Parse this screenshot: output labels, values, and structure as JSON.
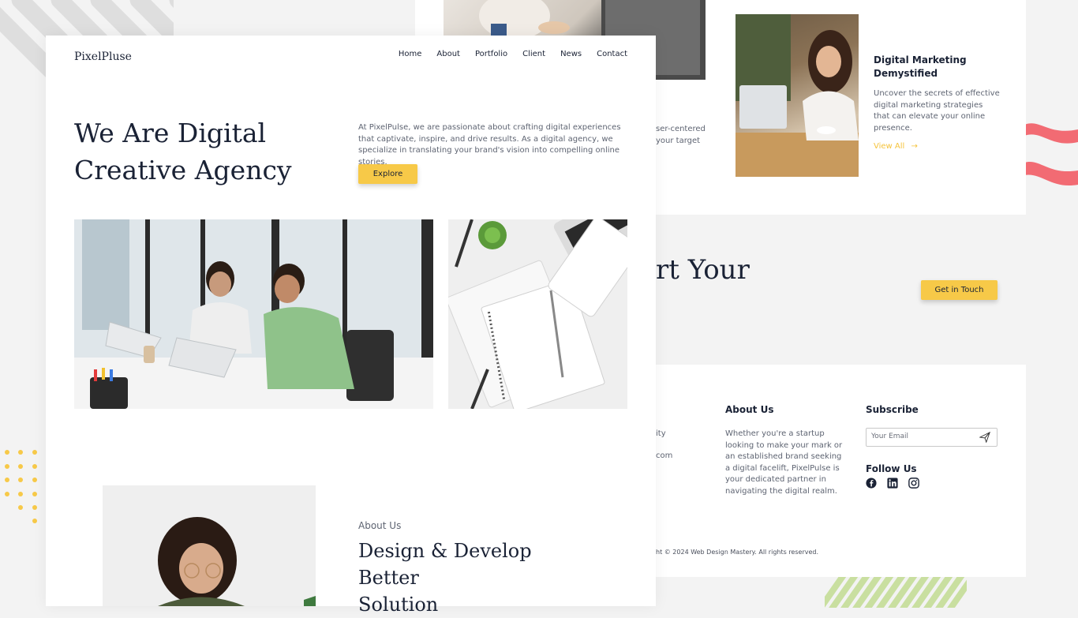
{
  "site": {
    "logo": "PixelPluse"
  },
  "nav": [
    "Home",
    "About",
    "Portfolio",
    "Client",
    "News",
    "Contact"
  ],
  "hero": {
    "title_line1": "We Are Digital",
    "title_line2": "Creative Agency",
    "text": "At PixelPulse, we are passionate about crafting digital experiences that captivate, inspire, and drive results. As a digital agency, we specialize in translating your brand's vision into compelling online stories.",
    "button": "Explore"
  },
  "about": {
    "label": "About Us",
    "title_line1": "Design & Develop Better",
    "title_line2": "Solution"
  },
  "back": {
    "cut_line1": "ser-centered",
    "cut_line2": "your target",
    "blog_title": "Digital Marketing Demystified",
    "blog_text": "Uncover the secrets of effective digital marketing strategies that can elevate your online presence.",
    "blog_link": "View All",
    "cta_heading_partial": "rt Your",
    "cta_button": "Get in Touch",
    "footer_cut1": "ity",
    "footer_cut2": "com",
    "footer_about_title": "About Us",
    "footer_about_text": "Whether you're a startup looking to make your mark or an established brand seeking a digital facelift, PixelPulse is your dedicated partner in navigating the digital realm.",
    "subscribe_title": "Subscribe",
    "email_placeholder": "Your Email",
    "follow_title": "Follow Us",
    "social": [
      "facebook-icon",
      "linkedin-icon",
      "instagram-icon"
    ],
    "copyright": "ht © 2024 Web Design Mastery. All rights reserved."
  },
  "colors": {
    "accent": "#f7c948",
    "text": "#1a2235",
    "muted": "#5e6472",
    "wave": "#f26b73"
  }
}
